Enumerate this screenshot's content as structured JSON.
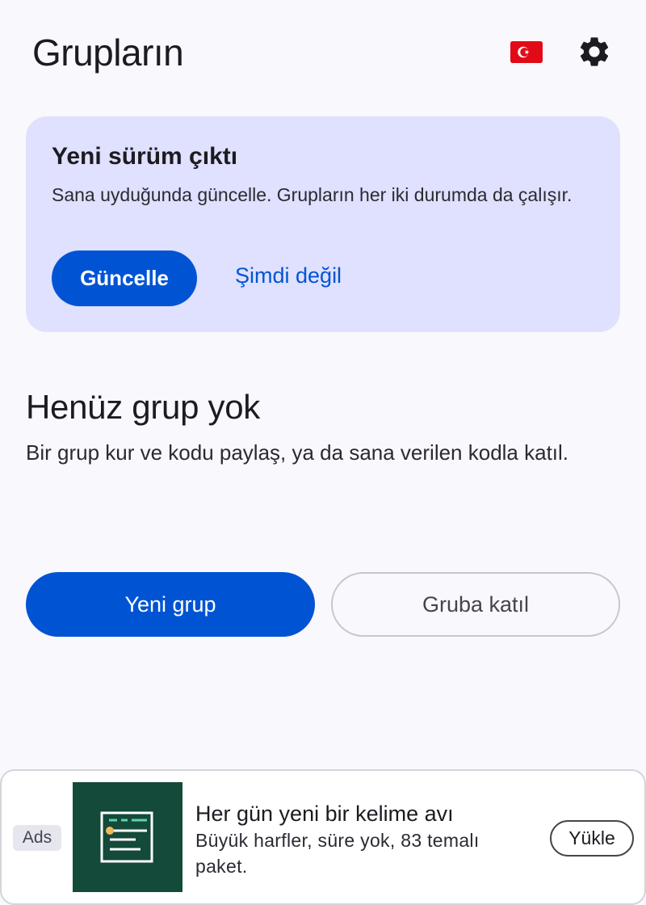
{
  "header": {
    "title": "Grupların",
    "flag_icon": "turkey-flag-icon",
    "settings_icon": "gear-icon"
  },
  "update_card": {
    "title": "Yeni sürüm çıktı",
    "body": "Sana uyduğunda güncelle. Grupların her iki durumda da çalışır.",
    "update_label": "Güncelle",
    "later_label": "Şimdi değil"
  },
  "empty_state": {
    "title": "Henüz grup yok",
    "body": "Bir grup kur ve kodu paylaş, ya da sana verilen kodla katıl."
  },
  "actions": {
    "new_group_label": "Yeni grup",
    "join_group_label": "Gruba katıl"
  },
  "ad": {
    "badge": "Ads",
    "title": "Her gün yeni bir kelime avı",
    "description": "Büyük harfler, süre yok, 83 temalı paket.",
    "cta_label": "Yükle",
    "image_icon": "word-list-icon"
  },
  "colors": {
    "primary": "#0054d3",
    "card_bg": "#e0e0ff",
    "background": "#f9f8fd",
    "flag_red": "#e30a17",
    "ad_image_bg": "#134a3a"
  }
}
